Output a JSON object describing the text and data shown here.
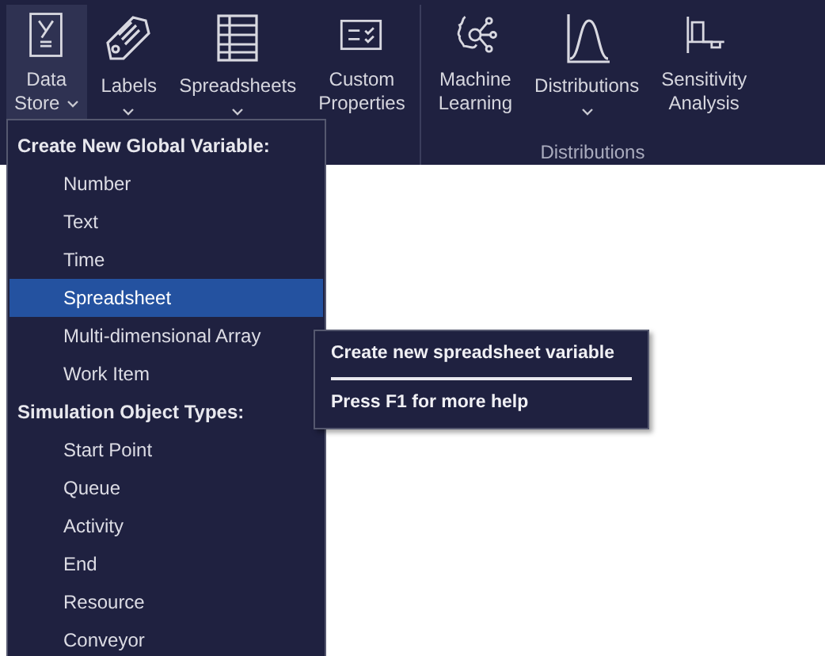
{
  "ribbon": {
    "groups": [
      {
        "buttons": [
          {
            "lines": [
              "Data",
              "Store"
            ],
            "dropdown": true,
            "selected": true
          },
          {
            "lines": [
              "Labels"
            ],
            "dropdown": true,
            "selected": false
          },
          {
            "lines": [
              "Spreadsheets"
            ],
            "dropdown": true,
            "selected": false
          },
          {
            "lines": [
              "Custom",
              "Properties"
            ],
            "dropdown": false,
            "selected": false
          }
        ]
      },
      {
        "label": "Distributions",
        "buttons": [
          {
            "lines": [
              "Machine",
              "Learning"
            ],
            "dropdown": false,
            "selected": false
          },
          {
            "lines": [
              "Distributions"
            ],
            "dropdown": true,
            "selected": false
          },
          {
            "lines": [
              "Sensitivity",
              "Analysis"
            ],
            "dropdown": false,
            "selected": false
          }
        ]
      }
    ]
  },
  "menu": {
    "sections": [
      {
        "heading": "Create New Global Variable:",
        "items": [
          {
            "label": "Number",
            "selected": false
          },
          {
            "label": "Text",
            "selected": false
          },
          {
            "label": "Time",
            "selected": false
          },
          {
            "label": "Spreadsheet",
            "selected": true
          },
          {
            "label": "Multi-dimensional Array",
            "selected": false
          },
          {
            "label": "Work Item",
            "selected": false
          }
        ]
      },
      {
        "heading": "Simulation Object Types:",
        "items": [
          {
            "label": "Start Point",
            "selected": false
          },
          {
            "label": "Queue",
            "selected": false
          },
          {
            "label": "Activity",
            "selected": false
          },
          {
            "label": "End",
            "selected": false
          },
          {
            "label": "Resource",
            "selected": false
          },
          {
            "label": "Conveyor",
            "selected": false
          }
        ]
      }
    ]
  },
  "tooltip": {
    "title": "Create new spreadsheet variable",
    "help": "Press F1 for more help"
  }
}
